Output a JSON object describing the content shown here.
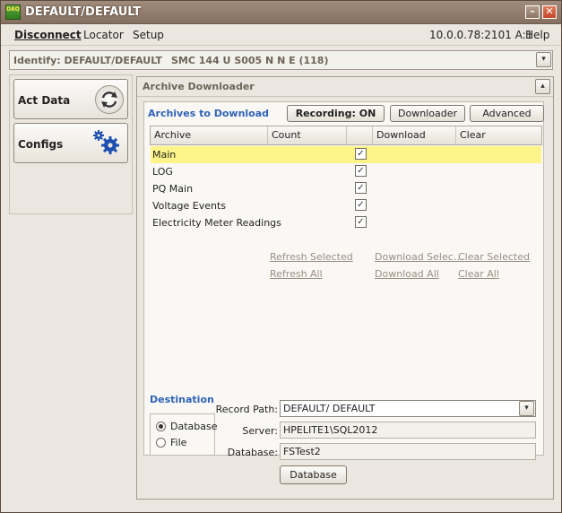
{
  "window": {
    "title": "DEFAULT/DEFAULT",
    "icon_text": "DAQ",
    "minimize_glyph": "–",
    "maximize_glyph": "□",
    "close_glyph": "✕"
  },
  "menu": {
    "disconnect": "Disconnect",
    "locator": "Locator",
    "setup": "Setup",
    "address": "10.0.0.78:2101 A:1",
    "help": "Help"
  },
  "identify": {
    "label": "Identify: DEFAULT/DEFAULT",
    "model": "SMC 144 U S005 N N E (118)"
  },
  "sidebar": {
    "act_data": "Act Data",
    "configs": "Configs"
  },
  "panel": {
    "title": "Archive Downloader",
    "archives_title": "Archives to Download",
    "recording_button": "Recording: ON",
    "downloader_button": "Downloader",
    "advanced_button": "Advanced",
    "columns": [
      "Archive",
      "Count",
      "",
      "Download",
      "Clear"
    ],
    "rows": [
      {
        "name": "Main",
        "checked": true,
        "selected": true
      },
      {
        "name": "LOG",
        "checked": true,
        "selected": false
      },
      {
        "name": "PQ Main",
        "checked": true,
        "selected": false
      },
      {
        "name": "Voltage Events",
        "checked": true,
        "selected": false
      },
      {
        "name": "Electricity Meter Readings",
        "checked": true,
        "selected": false
      }
    ],
    "check_glyph": "✓",
    "links": {
      "refresh_selected": "Refresh Selected",
      "refresh_all": "Refresh All",
      "download_selected": "Download Selec…",
      "download_all": "Download All",
      "clear_selected": "Clear Selected",
      "clear_all": "Clear All"
    }
  },
  "destination": {
    "title": "Destination",
    "option_database": "Database",
    "option_file": "File",
    "selected_option": "Database",
    "record_path_label": "Record Path:",
    "record_path_value": "DEFAULT/ DEFAULT",
    "server_label": "Server:",
    "server_value": "HPELITE1\\SQL2012",
    "database_label": "Database:",
    "database_value": "FSTest2",
    "database_button": "Database"
  },
  "colors": {
    "accent_title": "#2f62b8",
    "selected_row": "#fdf58a",
    "gear_blue": "#1d4fb0"
  },
  "icons": {
    "combo": "▾"
  }
}
